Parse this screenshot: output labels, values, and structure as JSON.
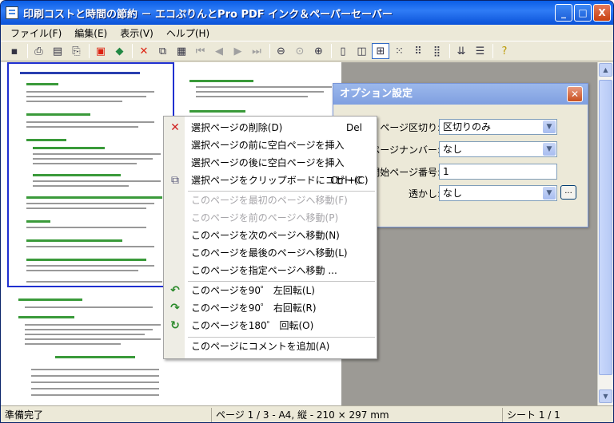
{
  "title": "印刷コストと時間の節約 － エコぷりんとPro PDF インク＆ペーパーセーバー",
  "window_buttons": {
    "minimize": "_",
    "maximize": "□",
    "close": "X"
  },
  "menu": [
    "ファイル(F)",
    "編集(E)",
    "表示(V)",
    "ヘルプ(H)"
  ],
  "toolbar_icons": [
    "save-icon",
    "print-icon",
    "print-preview-icon",
    "printer-settings-icon",
    "pdf-icon",
    "eco-icon",
    "delete-icon",
    "copy-icon",
    "paste-icon",
    "first-page-icon",
    "prev-page-icon",
    "next-page-icon",
    "last-page-icon",
    "zoom-out-icon",
    "zoom-reset-icon",
    "zoom-in-icon",
    "single-page-icon",
    "two-page-icon",
    "grid4-icon",
    "grid6-icon",
    "grid8-icon",
    "grid12-icon",
    "sort-icon",
    "list-icon",
    "help-icon"
  ],
  "dialog": {
    "title": "オプション設定",
    "rows": [
      {
        "label": "ページ区切り:",
        "value": "区切りのみ",
        "type": "select"
      },
      {
        "label": "ページナンバー:",
        "value": "なし",
        "type": "select"
      },
      {
        "label": "開始ページ番号:",
        "value": "1",
        "type": "text"
      },
      {
        "label": "透かし:",
        "value": "なし",
        "type": "select"
      }
    ],
    "more_label": "..."
  },
  "context_menu": {
    "items": [
      {
        "label": "選択ページの削除(D)",
        "shortcut": "Del",
        "icon": "delete-x-icon",
        "enabled": true
      },
      {
        "label": "選択ページの前に空白ページを挿入",
        "enabled": true
      },
      {
        "label": "選択ページの後に空白ページを挿入",
        "enabled": true
      },
      {
        "label": "選択ページをクリップボードにコピー(C)",
        "shortcut": "Ctrl+C",
        "icon": "copy-icon",
        "enabled": true
      },
      {
        "label": "このページを最初のページへ移動(F)",
        "enabled": false
      },
      {
        "label": "このページを前のページへ移動(P)",
        "enabled": false
      },
      {
        "label": "このページを次のページへ移動(N)",
        "enabled": true
      },
      {
        "label": "このページを最後のページへ移動(L)",
        "enabled": true
      },
      {
        "label": "このページを指定ページへ移動 ...",
        "enabled": true
      },
      {
        "label": "このページを90゜ 左回転(L)",
        "icon": "rotate-left-icon",
        "enabled": true
      },
      {
        "label": "このページを90゜ 右回転(R)",
        "icon": "rotate-right-icon",
        "enabled": true
      },
      {
        "label": "このページを180゜ 回転(O)",
        "icon": "rotate-180-icon",
        "enabled": true
      },
      {
        "label": "このページにコメントを追加(A)",
        "enabled": true
      }
    ]
  },
  "status": {
    "left": "準備完了",
    "middle": "ページ 1 / 3 - A4, 縦 - 210 × 297 mm",
    "right": "シート 1 / 1"
  },
  "colors": {
    "title_bar": "#0a5ee6",
    "selection_border": "#2030d0",
    "dialog_title": "#7f9fe0"
  }
}
